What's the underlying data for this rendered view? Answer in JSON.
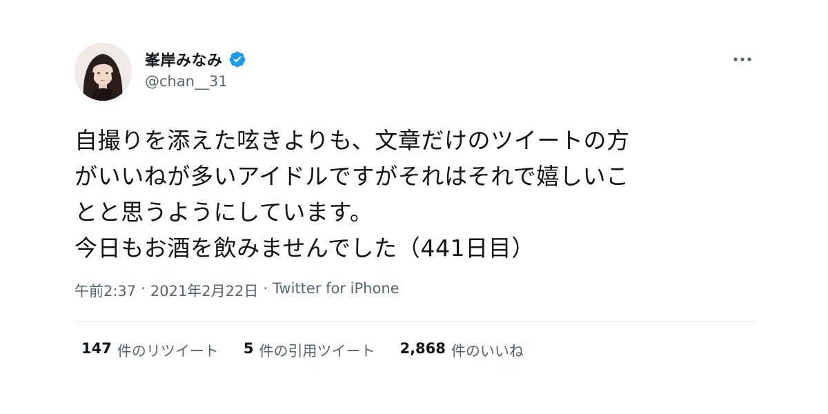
{
  "user": {
    "display_name": "峯岸みなみ",
    "handle": "@chan__31",
    "verified": true,
    "avatar_icon": "profile-photo-avatar"
  },
  "tweet": {
    "text_lines": [
      "自撮りを添えた呟きよりも、文章だけのツイートの方",
      "がいいねが多いアイドルですがそれはそれで嬉しいこ",
      "とと思うようにしています。",
      "今日もお酒を飲みませんでした（441日目）"
    ],
    "time": "午前2:37",
    "date": "2021年2月22日",
    "separator": "·",
    "source": "Twitter for iPhone"
  },
  "stats": [
    {
      "count": "147",
      "label": "件のリツイート"
    },
    {
      "count": "5",
      "label": "件の引用ツイート"
    },
    {
      "count": "2,868",
      "label": "件のいいね"
    }
  ],
  "colors": {
    "text_primary": "#0f1419",
    "text_secondary": "#536471",
    "verified_blue": "#1d9bf0",
    "divider": "#e3e7ea"
  },
  "icons": {
    "verified": "verified-badge-icon",
    "more": "more-options-icon"
  }
}
